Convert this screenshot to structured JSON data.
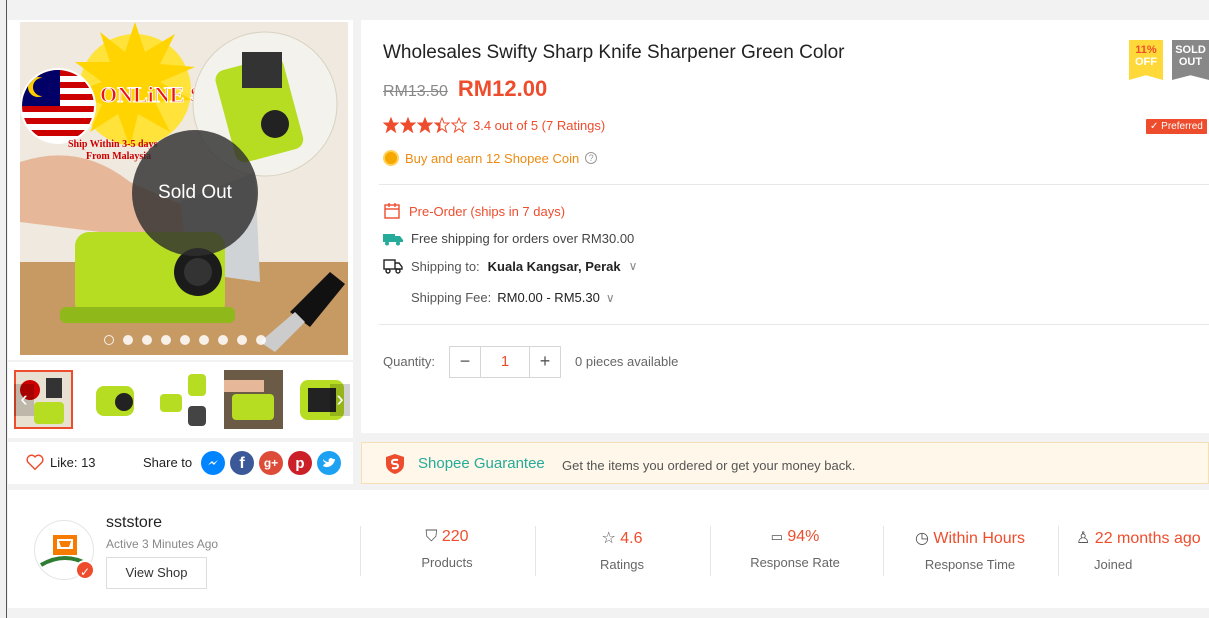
{
  "gallery": {
    "sold_out_label": "Sold Out",
    "badge_title": "ONLiNE SHOP!",
    "badge_subtitle": "Ship Within 3-5 days From Malaysia",
    "dot_count": 9,
    "active_dot": 0
  },
  "social": {
    "like_label": "Like: 13",
    "share_label": "Share to",
    "share_targets": [
      "messenger-icon",
      "facebook-icon",
      "google-plus-icon",
      "pinterest-icon",
      "twitter-icon"
    ]
  },
  "product": {
    "title": "Wholesales Swifty Sharp Knife Sharpener Green Color",
    "original_price": "RM13.50",
    "price": "RM12.00",
    "rating_text": "3.4 out of 5 (7 Ratings)",
    "rating": 3.4,
    "rating_max": 5,
    "coin_text": "Buy and earn 12 Shopee Coin",
    "discount_pct": "11%",
    "discount_label": "OFF",
    "sold_label_1": "SOLD",
    "sold_label_2": "OUT",
    "preferred_label": "Preferred"
  },
  "shipping": {
    "preorder": "Pre-Order (ships in 7 days)",
    "free_shipping": "Free shipping for orders over RM30.00",
    "to_label": "Shipping to:",
    "to_value": "Kuala Kangsar, Perak",
    "fee_label": "Shipping Fee:",
    "fee_value": "RM0.00 - RM5.30"
  },
  "quantity": {
    "label": "Quantity:",
    "value": "1",
    "minus": "−",
    "plus": "+",
    "available": "0 pieces available"
  },
  "guarantee": {
    "title": "Shopee Guarantee",
    "text": "Get the items you ordered or get your money back."
  },
  "shop": {
    "name": "sststore",
    "active": "Active 3 Minutes Ago",
    "view_shop": "View Shop",
    "stats": [
      {
        "icon": "shirt-icon",
        "value": "220",
        "label": "Products"
      },
      {
        "icon": "star-outline-icon",
        "value": "4.6",
        "label": "Ratings"
      },
      {
        "icon": "chat-icon",
        "value": "94%",
        "label": "Response Rate"
      },
      {
        "icon": "clock-icon",
        "value": "Within Hours",
        "label": "Response Time"
      },
      {
        "icon": "user-icon",
        "value": "22 months ago",
        "label": "Joined"
      }
    ]
  },
  "colors": {
    "accent": "#ee4d2d",
    "gold": "#ec8b12",
    "teal": "#26aa99",
    "star": "#ee4d2d",
    "product_green": "#b6dd22"
  }
}
